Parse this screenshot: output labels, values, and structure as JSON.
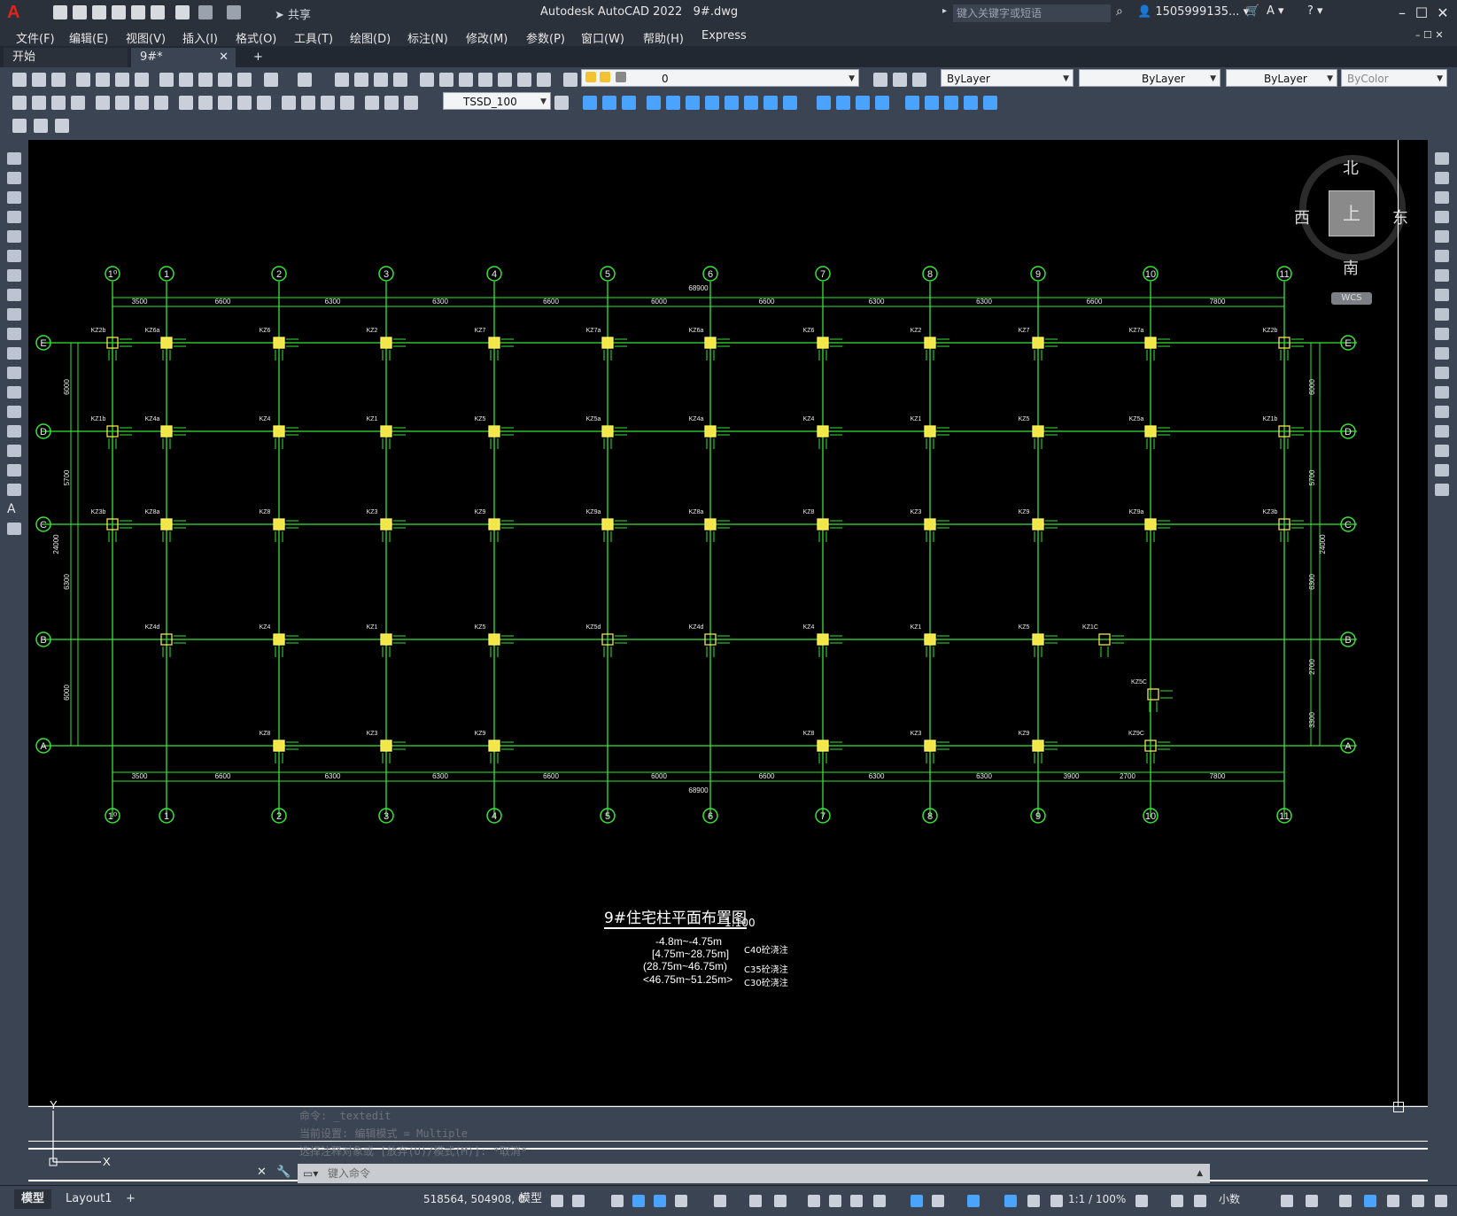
{
  "titlebar": {
    "app_title": "Autodesk AutoCAD 2022",
    "file_name": "9#.dwg",
    "share_label": "共享",
    "search_placeholder": "键入关键字或短语",
    "user": "1505999135...",
    "logo": "A"
  },
  "menu": [
    "文件(F)",
    "编辑(E)",
    "视图(V)",
    "插入(I)",
    "格式(O)",
    "工具(T)",
    "绘图(D)",
    "标注(N)",
    "修改(M)",
    "参数(P)",
    "窗口(W)",
    "帮助(H)",
    "Express"
  ],
  "tabs": [
    {
      "label": "开始"
    },
    {
      "label": "9#*"
    }
  ],
  "toolbar": {
    "layer_value": "0",
    "color_value": "ByLayer",
    "linetype_value": "ByLayer",
    "lineweight_value": "ByLayer",
    "plotstyle_value": "ByColor",
    "dimstyle_value": "TSSD_100"
  },
  "compass": {
    "north": "北",
    "south": "南",
    "east": "东",
    "west": "西",
    "top": "上",
    "wcs": "WCS"
  },
  "grid": {
    "columns": [
      "1⁰",
      "1",
      "2",
      "3",
      "4",
      "5",
      "6",
      "7",
      "8",
      "9",
      "10",
      "11"
    ],
    "rows": [
      "E",
      "D",
      "C",
      "B",
      "A"
    ],
    "top_dims": [
      "3500",
      "6600",
      "6300",
      "6300",
      "6600",
      "6000",
      "6600",
      "6300",
      "6300",
      "6600",
      "7800"
    ],
    "bottom_dims": [
      "3500",
      "6600",
      "6300",
      "6300",
      "6600",
      "6000",
      "6600",
      "6300",
      "6300",
      "3900",
      "2700",
      "7800"
    ],
    "total": "68900",
    "left_dims": [
      "6000",
      "5700",
      "6300",
      "6000"
    ],
    "right_dims": [
      "6000",
      "5700",
      "6300",
      "2700",
      "3300"
    ],
    "overall_v": "24000"
  },
  "column_names": {
    "E": [
      "KZ2b",
      "KZ6a",
      "KZ6",
      "KZ2",
      "KZ7",
      "KZ7a",
      "KZ6a",
      "KZ6",
      "KZ2",
      "KZ7",
      "KZ7a",
      "KZ2b"
    ],
    "D": [
      "KZ1b",
      "KZ4a",
      "KZ4",
      "KZ1",
      "KZ5",
      "KZ5a",
      "KZ4a",
      "KZ4",
      "KZ1",
      "KZ5",
      "KZ5a",
      "KZ1b"
    ],
    "C": [
      "KZ3b",
      "KZ8a",
      "KZ8",
      "KZ3",
      "KZ9",
      "KZ9a",
      "KZ8a",
      "KZ8",
      "KZ3",
      "KZ9",
      "KZ9a",
      "KZ3b"
    ],
    "B": [
      "KZ4d",
      "KZ4",
      "KZ1",
      "KZ5",
      "KZ5d",
      "KZ4d",
      "KZ4",
      "KZ1",
      "KZ5",
      "KZ1C",
      "KZ5C"
    ],
    "A": [
      "KZ8",
      "KZ3",
      "KZ9",
      "KZ8",
      "KZ3",
      "KZ9",
      "KZ9C"
    ]
  },
  "drawing": {
    "title": "9#住宅柱平面布置图",
    "scale": "1:100",
    "elevations": [
      "-4.8m~-4.75m",
      "[4.75m~28.75m]",
      "(28.75m~46.75m)",
      "<46.75m~51.25m>"
    ],
    "concrete": [
      "C40砼浇注",
      "C35砼浇注",
      "C30砼浇注"
    ]
  },
  "command": {
    "history": [
      "命令: _textedit",
      "当前设置: 编辑模式 = Multiple",
      "选择注释对象或 [放弃(U)/模式(M)]: *取消*"
    ],
    "placeholder": "键入命令"
  },
  "status": {
    "model_tab": "模型",
    "layout_tab": "Layout1",
    "coords": "518564, 504908, 0",
    "mode": "模型",
    "scale": "1:1 / 100%",
    "units": "小数"
  }
}
